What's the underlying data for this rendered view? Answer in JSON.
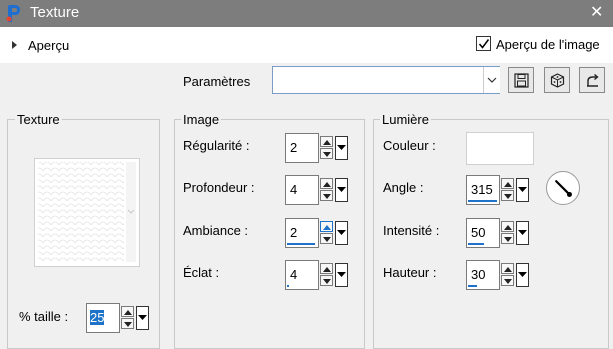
{
  "window": {
    "title": "Texture",
    "close_glyph": "✕"
  },
  "preview": {
    "label": "Aperçu",
    "checkbox_label": "Aperçu de l'image",
    "checked": true
  },
  "params": {
    "label": "Paramètres",
    "value": ""
  },
  "toolbar_icons": [
    "save-icon",
    "randomize-icon",
    "reset-icon"
  ],
  "groups": {
    "texture": {
      "title": "Texture",
      "size_label": "% taille :",
      "size_value": "25"
    },
    "image": {
      "title": "Image",
      "fields": [
        {
          "label": "Régularité :",
          "value": "2",
          "fill": 0.0
        },
        {
          "label": "Profondeur :",
          "value": "4",
          "fill": 0.0
        },
        {
          "label": "Ambiance :",
          "value": "2",
          "fill": 0.9
        },
        {
          "label": "Éclat :",
          "value": "4",
          "fill": 0.05
        }
      ]
    },
    "lumiere": {
      "title": "Lumière",
      "color_label": "Couleur :",
      "color_value": "#ffffff",
      "fields": [
        {
          "label": "Angle :",
          "value": "315",
          "fill": 0.95
        },
        {
          "label": "Intensité :",
          "value": "50",
          "fill": 0.5
        },
        {
          "label": "Hauteur :",
          "value": "30",
          "fill": 0.3
        }
      ],
      "angle_degrees": 315
    }
  }
}
